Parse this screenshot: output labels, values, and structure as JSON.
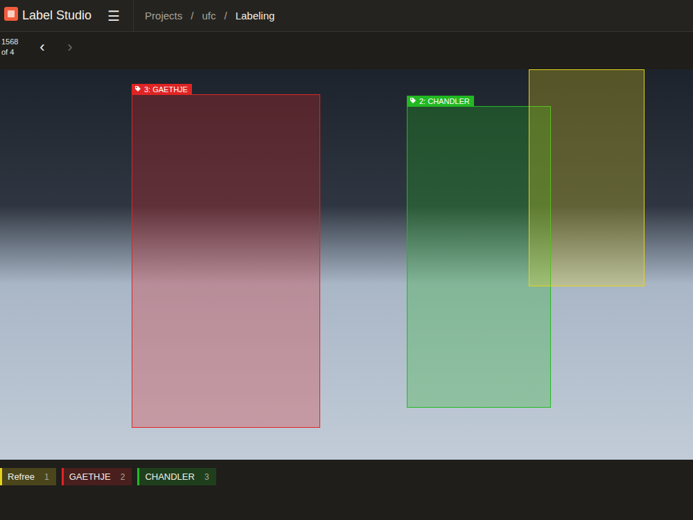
{
  "app": {
    "title": "Label Studio",
    "menu_icon": "☰"
  },
  "breadcrumbs": {
    "separator": "/",
    "items": [
      {
        "label": "Projects",
        "selected": false
      },
      {
        "label": "ufc",
        "selected": false
      },
      {
        "label": "Labeling",
        "selected": true
      }
    ]
  },
  "task_nav": {
    "current": "1568",
    "total": "of 4",
    "prev": "‹",
    "next": "›",
    "prev_disabled": false,
    "next_disabled": true
  },
  "regions": [
    {
      "label": "3: GAETHJE",
      "color": "#e02424"
    },
    {
      "label": "2: CHANDLER",
      "color": "#22b822"
    },
    {
      "color": "#e6d31c"
    }
  ],
  "labels": [
    {
      "name": "Refree",
      "hotkey": "1",
      "color": "#e6d31c"
    },
    {
      "name": "GAETHJE",
      "hotkey": "2",
      "color": "#e02424"
    },
    {
      "name": "CHANDLER",
      "hotkey": "3",
      "color": "#22b822"
    }
  ]
}
